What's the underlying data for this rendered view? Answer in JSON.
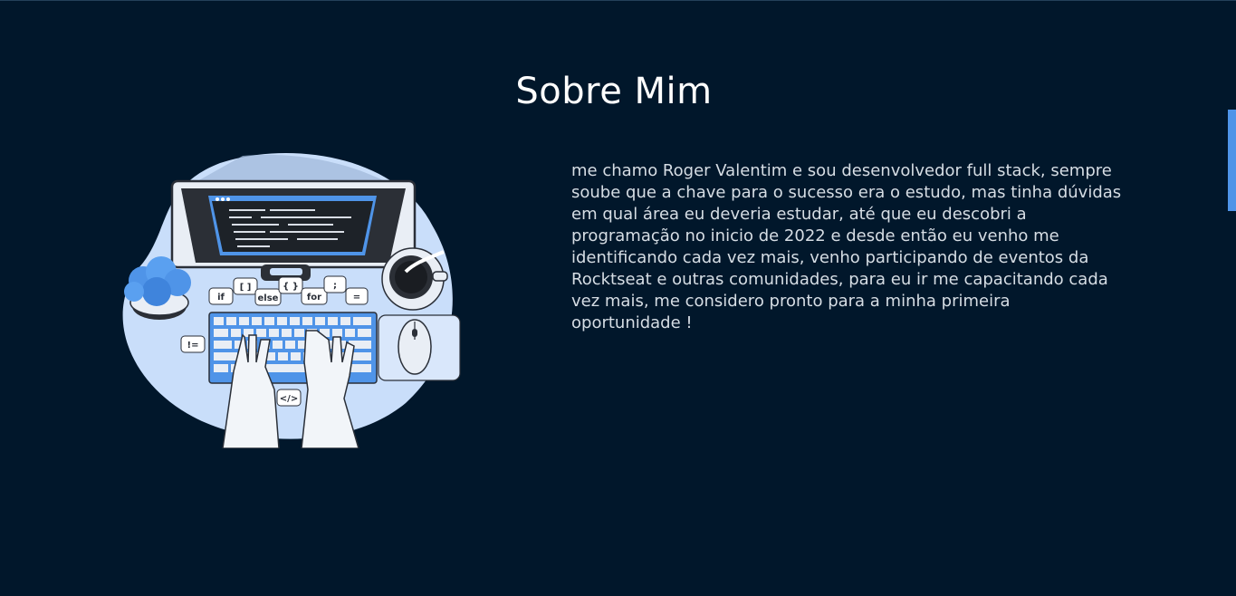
{
  "section": {
    "title": "Sobre Mim",
    "about_text": "me chamo Roger Valentim e sou desenvolvedor full stack, sempre soube que a chave para o sucesso era o estudo, mas tinha dúvidas em qual área eu deveria estudar, até que eu descobri a programação no inicio de 2022 e desde então eu venho me identificando cada vez mais, venho participando de eventos da Rocktseat e outras comunidades, para eu ir me capacitando cada vez mais, me considero pronto para a minha primeira oportunidade !"
  },
  "illustration": {
    "keywords": [
      "if",
      "[ ]",
      "else",
      "{ }",
      "for",
      ";",
      "=",
      "!=",
      "</>"
    ]
  },
  "colors": {
    "background": "#01172b",
    "title": "#ffffff",
    "text": "#d6dde4",
    "accent": "#4f94e8",
    "blob": "#c9defa"
  }
}
